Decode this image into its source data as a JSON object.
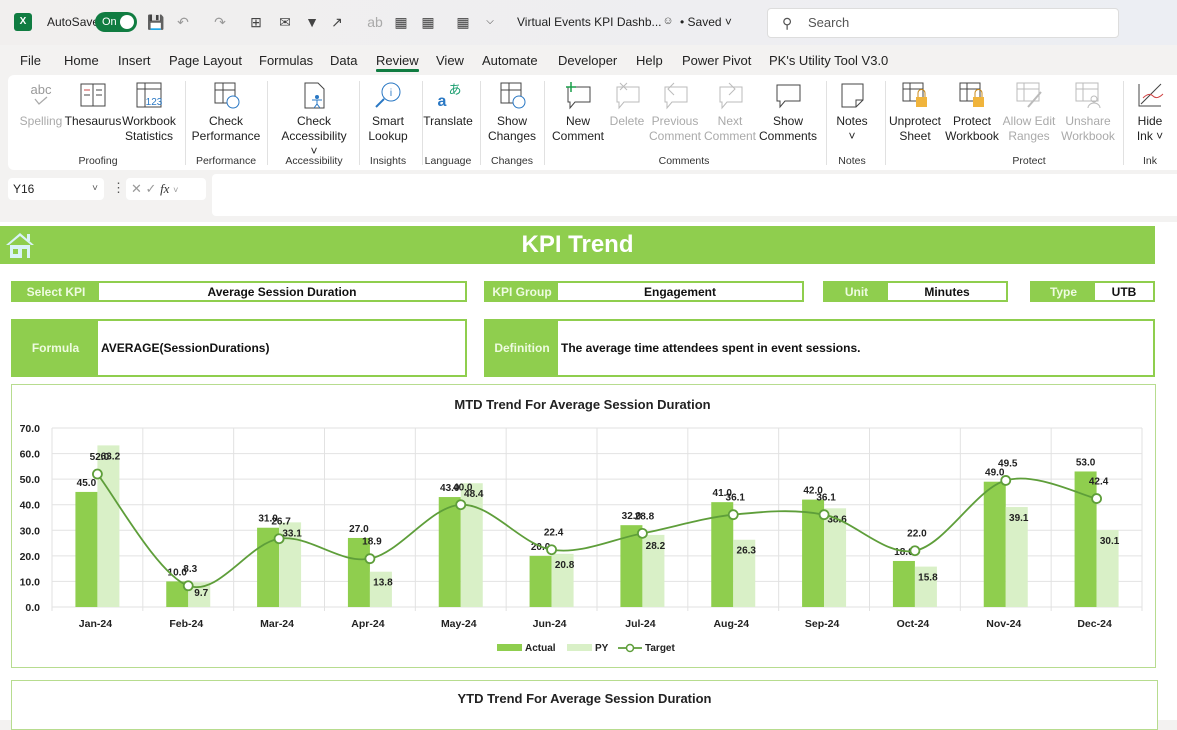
{
  "titlebar": {
    "app_icon": "excel-icon",
    "autosave_label": "AutoSave",
    "autosave_state": "On",
    "doc_title": "Virtual Events KPI Dashb...",
    "saved_status": "• Saved",
    "search_placeholder": "Search"
  },
  "menu": [
    "File",
    "Home",
    "Insert",
    "Page Layout",
    "Formulas",
    "Data",
    "Review",
    "View",
    "Automate",
    "Developer",
    "Help",
    "Power Pivot",
    "PK's Utility Tool V3.0"
  ],
  "active_menu": "Review",
  "ribbon": {
    "buttons": [
      {
        "l1": "Spelling",
        "l2": "",
        "icon": "spelling-icon",
        "disabled": true
      },
      {
        "l1": "Thesaurus",
        "l2": "",
        "icon": "thesaurus-icon",
        "disabled": false
      },
      {
        "l1": "Workbook",
        "l2": "Statistics",
        "icon": "workbook-statistics-icon",
        "disabled": false
      },
      {
        "l1": "Check",
        "l2": "Performance",
        "icon": "check-performance-icon",
        "disabled": false
      },
      {
        "l1": "Check",
        "l2": "Accessibility ˅",
        "icon": "check-accessibility-icon",
        "disabled": false
      },
      {
        "l1": "Smart",
        "l2": "Lookup",
        "icon": "smart-lookup-icon",
        "disabled": false
      },
      {
        "l1": "Translate",
        "l2": "",
        "icon": "translate-icon",
        "disabled": false
      },
      {
        "l1": "Show",
        "l2": "Changes",
        "icon": "show-changes-icon",
        "disabled": false
      },
      {
        "l1": "New",
        "l2": "Comment",
        "icon": "new-comment-icon",
        "disabled": false
      },
      {
        "l1": "Delete",
        "l2": "",
        "icon": "delete-comment-icon",
        "disabled": true
      },
      {
        "l1": "Previous",
        "l2": "Comment",
        "icon": "previous-comment-icon",
        "disabled": true
      },
      {
        "l1": "Next",
        "l2": "Comment",
        "icon": "next-comment-icon",
        "disabled": true
      },
      {
        "l1": "Show",
        "l2": "Comments",
        "icon": "show-comments-icon",
        "disabled": false
      },
      {
        "l1": "Notes",
        "l2": "˅",
        "icon": "notes-icon",
        "disabled": false
      },
      {
        "l1": "Unprotect",
        "l2": "Sheet",
        "icon": "unprotect-sheet-icon",
        "disabled": false
      },
      {
        "l1": "Protect",
        "l2": "Workbook",
        "icon": "protect-workbook-icon",
        "disabled": false
      },
      {
        "l1": "Allow Edit",
        "l2": "Ranges",
        "icon": "allow-edit-ranges-icon",
        "disabled": true
      },
      {
        "l1": "Unshare",
        "l2": "Workbook",
        "icon": "unshare-workbook-icon",
        "disabled": true
      },
      {
        "l1": "Hide",
        "l2": "Ink ˅",
        "icon": "hide-ink-icon",
        "disabled": false
      }
    ],
    "groups": [
      "Proofing",
      "Performance",
      "Accessibility",
      "Insights",
      "Language",
      "Changes",
      "Comments",
      "Notes",
      "Protect",
      "Ink"
    ]
  },
  "formula_bar": {
    "name_box": "Y16",
    "value": ""
  },
  "dashboard": {
    "title": "KPI Trend",
    "select_kpi_label": "Select KPI",
    "select_kpi_value": "Average Session Duration",
    "kpi_group_label": "KPI Group",
    "kpi_group_value": "Engagement",
    "unit_label": "Unit",
    "unit_value": "Minutes",
    "type_label": "Type",
    "type_value": "UTB",
    "formula_label": "Formula",
    "formula_value": "AVERAGE(SessionDurations)",
    "definition_label": "Definition",
    "definition_value": "The average time attendees spent in event sessions.",
    "ytd_title": "YTD Trend For Average Session Duration"
  },
  "colors": {
    "accent": "#8fce4e",
    "actual": "#8fce4e",
    "py": "#d9f0c7",
    "target": "#5e9e3a",
    "excel_green": "#107c41"
  },
  "chart_data": {
    "type": "bar",
    "title": "MTD Trend For Average Session Duration",
    "xlabel": "",
    "ylabel": "",
    "ylim": [
      0,
      70
    ],
    "yticks": [
      "0.0",
      "10.0",
      "20.0",
      "30.0",
      "40.0",
      "50.0",
      "60.0",
      "70.0"
    ],
    "grid": true,
    "legend": "bottom",
    "categories": [
      "Jan-24",
      "Feb-24",
      "Mar-24",
      "Apr-24",
      "May-24",
      "Jun-24",
      "Jul-24",
      "Aug-24",
      "Sep-24",
      "Oct-24",
      "Nov-24",
      "Dec-24"
    ],
    "series": [
      {
        "name": "Actual",
        "kind": "bar",
        "values": [
          45.0,
          10.0,
          31.0,
          27.0,
          43.0,
          20.0,
          32.0,
          41.0,
          42.0,
          18.0,
          49.0,
          53.0
        ]
      },
      {
        "name": "PY",
        "kind": "bar",
        "values": [
          63.2,
          9.7,
          33.1,
          13.8,
          48.4,
          20.8,
          28.2,
          26.3,
          38.6,
          15.8,
          39.1,
          30.1
        ]
      },
      {
        "name": "Target",
        "kind": "line",
        "values": [
          52.0,
          8.3,
          26.7,
          18.9,
          40.0,
          22.4,
          28.8,
          36.1,
          36.1,
          22.0,
          49.5,
          42.4
        ]
      }
    ]
  }
}
